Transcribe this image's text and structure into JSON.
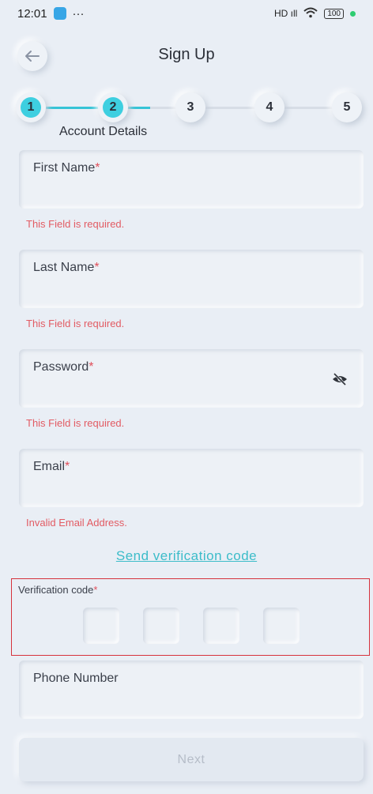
{
  "status_bar": {
    "time": "12:01",
    "more": "···",
    "signal": "HD ıll",
    "battery": "100"
  },
  "header": {
    "title": "Sign Up"
  },
  "stepper": {
    "steps": [
      "1",
      "2",
      "3",
      "4",
      "5"
    ],
    "current_step": 2,
    "caption": "Account Details"
  },
  "form": {
    "required_mark": "*",
    "first_name": {
      "label": "First Name",
      "value": "",
      "error": "This Field is required."
    },
    "last_name": {
      "label": "Last Name",
      "value": "",
      "error": "This Field is required."
    },
    "password": {
      "label": "Password",
      "value": "",
      "error": "This Field is required."
    },
    "email": {
      "label": "Email",
      "value": "",
      "error": "Invalid Email Address."
    },
    "send_code_link": "Send verification code",
    "verification": {
      "label": "Verification code",
      "digits": [
        "",
        "",
        "",
        ""
      ]
    },
    "phone": {
      "label": "Phone Number",
      "value": ""
    }
  },
  "next_button": "Next",
  "icons": {
    "back": "back-arrow-icon",
    "password_toggle": "eye-slash-icon"
  },
  "colors": {
    "accent": "#3ecfe0",
    "error": "#e25b63",
    "highlight_border": "#d6323c"
  }
}
